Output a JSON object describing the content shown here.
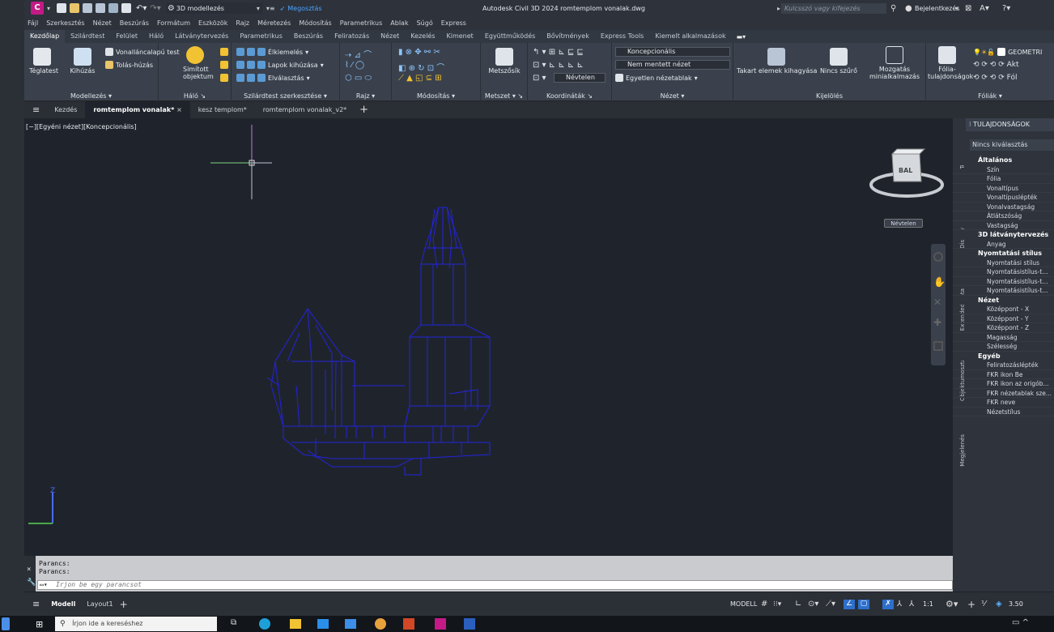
{
  "app": {
    "workspace": "3D modellezés",
    "share": "Megosztás",
    "title": "Autodesk Civil 3D 2024   romtemplom vonalak.dwg",
    "search_placeholder": "Kulcsszó vagy kifejezés",
    "login": "Bejelentkezés",
    "accent": "#c31a86"
  },
  "menu": [
    "Fájl",
    "Szerkesztés",
    "Nézet",
    "Beszúrás",
    "Formátum",
    "Eszközök",
    "Rajz",
    "Méretezés",
    "Módosítás",
    "Parametrikus",
    "Ablak",
    "Súgó",
    "Express"
  ],
  "ribbon_tabs": [
    "Kezdőlap",
    "Szilárdtest",
    "Felület",
    "Háló",
    "Látványtervezés",
    "Parametrikus",
    "Beszúrás",
    "Feliratozás",
    "Nézet",
    "Kezelés",
    "Kimenet",
    "Együttműködés",
    "Bővítmények",
    "Express Tools",
    "Kiemelt alkalmazások"
  ],
  "ribbon": {
    "modeling": {
      "title": "Modellezés",
      "teglatest": "Téglatest",
      "kihuzas": "Kihúzás",
      "vonallanc": "Vonalláncalapú test",
      "tolas": "Tolás-húzás"
    },
    "halo": {
      "title": "Háló",
      "simitott": "Simított",
      "objektum": "objektum"
    },
    "solid": {
      "title": "Szilárdtest szerkesztése",
      "elkiemeles": "Élkiemelés",
      "lapok": "Lapok kihúzása",
      "elvalasztas": "Elválasztás"
    },
    "rajz": {
      "title": "Rajz"
    },
    "modositas": {
      "title": "Módosítás"
    },
    "metszet": {
      "title": "Metszet",
      "metszosik": "Metszősík"
    },
    "koord": {
      "title": "Koordináták",
      "nevtelen": "Névtelen"
    },
    "nezet": {
      "title": "Nézet",
      "style": "Koncepcionális",
      "unsaved": "Nem mentett nézet",
      "egyetlen": "Egyetlen nézetablak"
    },
    "takart": "Takart elemek kihagyása",
    "nincs_szuro": "Nincs szűrő",
    "mozgatas": "Mozgatás",
    "minialk": "minialkalmazás",
    "folia_tul1": "Fólia-",
    "folia_tul2": "tulajdonságok",
    "kijeloles": "Kijelölés",
    "foliak": "Fóliák",
    "geometria": "GEOMETRI"
  },
  "doc_tabs": [
    "Kezdés",
    "romtemplom vonalak*",
    "kesz templom*",
    "romtemplom vonalak_v2*"
  ],
  "viewport": {
    "label": "[−][Egyéni nézet][Koncepcionális]",
    "viewcube": "BAL",
    "named": "Névtelen"
  },
  "command": {
    "line1": "Parancs:",
    "line2": "Parancs:",
    "placeholder": "Írjon be egy parancsot"
  },
  "properties": {
    "header": "TULAJDONSÁGOK",
    "selection": "Nincs kiválasztás",
    "side_tabs": [
      "Terv",
      "Display",
      "Extended Data",
      "Objektumosztály",
      "Megjelenés"
    ],
    "sections": [
      {
        "title": "Általános",
        "rows": [
          "Szín",
          "Fólia",
          "Vonaltípus",
          "Vonaltípuslépték",
          "Vonalvastagság",
          "Átlátszóság",
          "Vastagság"
        ]
      },
      {
        "title": "3D látványtervezés",
        "rows": [
          "Anyag"
        ]
      },
      {
        "title": "Nyomtatási stílus",
        "rows": [
          "Nyomtatási stílus",
          "Nyomtatásistílus-t...",
          "Nyomtatásistílus-t...",
          "Nyomtatásistílus-t..."
        ]
      },
      {
        "title": "Nézet",
        "rows": [
          "Középpont - X",
          "Középpont - Y",
          "Középpont - Z",
          "Magasság",
          "Szélesség"
        ]
      },
      {
        "title": "Egyéb",
        "rows": [
          "Feliratozáslépték",
          "FKR ikon Be",
          "FKR ikon az origób...",
          "FKR nézetablak sze...",
          "FKR neve",
          "Nézetstílus"
        ]
      }
    ]
  },
  "status": {
    "model_tab": "Modell",
    "layout_tab": "Layout1",
    "modell": "MODELL",
    "scale": "1:1",
    "zoom": "3.50"
  },
  "taskbar": {
    "search": "Írjon ide a kereséshez"
  }
}
